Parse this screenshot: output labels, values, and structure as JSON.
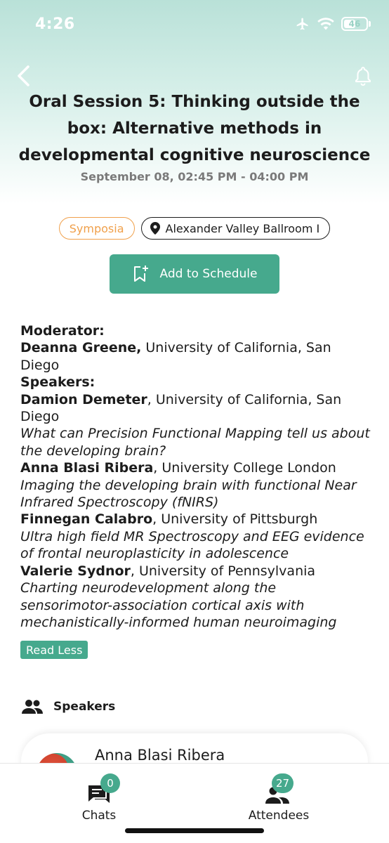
{
  "status_bar": {
    "time": "4:26",
    "battery": "46"
  },
  "session": {
    "title": "Oral Session 5: Thinking outside the box: Alternative methods in developmental cognitive neuroscience",
    "datetime": "September 08, 02:45 PM - 04:00 PM",
    "type_tag": "Symposia",
    "location": "Alexander Valley Ballroom I",
    "add_button": "Add to Schedule"
  },
  "details": {
    "moderator_heading": "Moderator:",
    "moderator": {
      "name": "Deanna Greene,",
      "affiliation": " University of California, San Diego"
    },
    "speakers_heading": "Speakers:",
    "speakers": [
      {
        "name": "Damion Demeter",
        "affiliation": ", University of California, San Diego",
        "talk": "What can Precision Functional Mapping tell us about the developing brain?"
      },
      {
        "name": "Anna Blasi Ribera",
        "affiliation": ", University College London",
        "talk": "Imaging the developing brain with functional Near Infrared Spectroscopy (fNIRS)"
      },
      {
        "name": "Finnegan Calabro",
        "affiliation": ", University of Pittsburgh",
        "talk": "Ultra high field MR Spectroscopy and EEG evidence of frontal neuroplasticity in adolescence"
      },
      {
        "name": "Valerie Sydnor",
        "affiliation": ", University of Pennsylvania",
        "talk": "Charting neurodevelopment along the sensorimotor-association cortical axis with mechanistically-informed human neuroimaging"
      }
    ],
    "read_less": "Read Less"
  },
  "speakers_section": {
    "label": "Speakers",
    "first_speaker": "Anna Blasi Ribera"
  },
  "bottom_nav": {
    "chats": {
      "label": "Chats",
      "count": "0"
    },
    "attendees": {
      "label": "Attendees",
      "count": "27"
    }
  },
  "colors": {
    "accent": "#46a98d",
    "tag_orange": "#f0a04b",
    "hero_top": "#b9e1d8"
  }
}
